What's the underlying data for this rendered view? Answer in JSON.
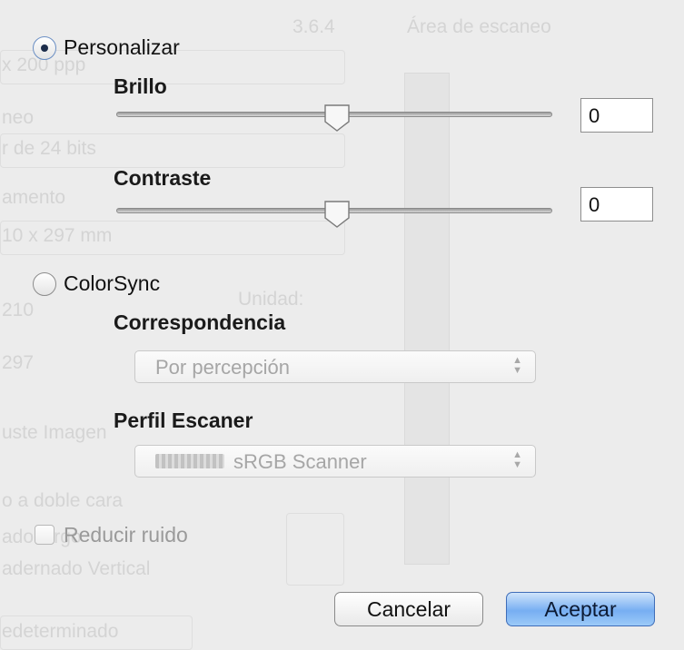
{
  "background": {
    "section_title_number": "3.6.4",
    "section_title": "Área de escaneo",
    "resolution_value": "x 200 ppp",
    "type_label": "neo",
    "color_value": "r de 24 bits",
    "size_label": "amento",
    "size_value": "10 x 297 mm",
    "width_value": "210",
    "units_label": "Unidad:",
    "height_value": "297",
    "adjust_label": "uste Imagen",
    "duplex_label": "o a doble cara",
    "binding_label": "ado largo",
    "binding_value": "adernado Vertical",
    "default_label": "edeterminado"
  },
  "dialog": {
    "custom_radio_label": "Personalizar",
    "brightness_label": "Brillo",
    "brightness_value": "0",
    "brightness_level": 0,
    "contrast_label": "Contraste",
    "contrast_value": "0",
    "contrast_level": 0,
    "colorsync_radio_label": "ColorSync",
    "matching_label": "Correspondencia",
    "matching_value": "Por percepción",
    "profile_label": "Perfil Escaner",
    "profile_value": "sRGB Scanner",
    "noise_label": "Reducir ruido",
    "cancel_label": "Cancelar",
    "accept_label": "Aceptar"
  }
}
